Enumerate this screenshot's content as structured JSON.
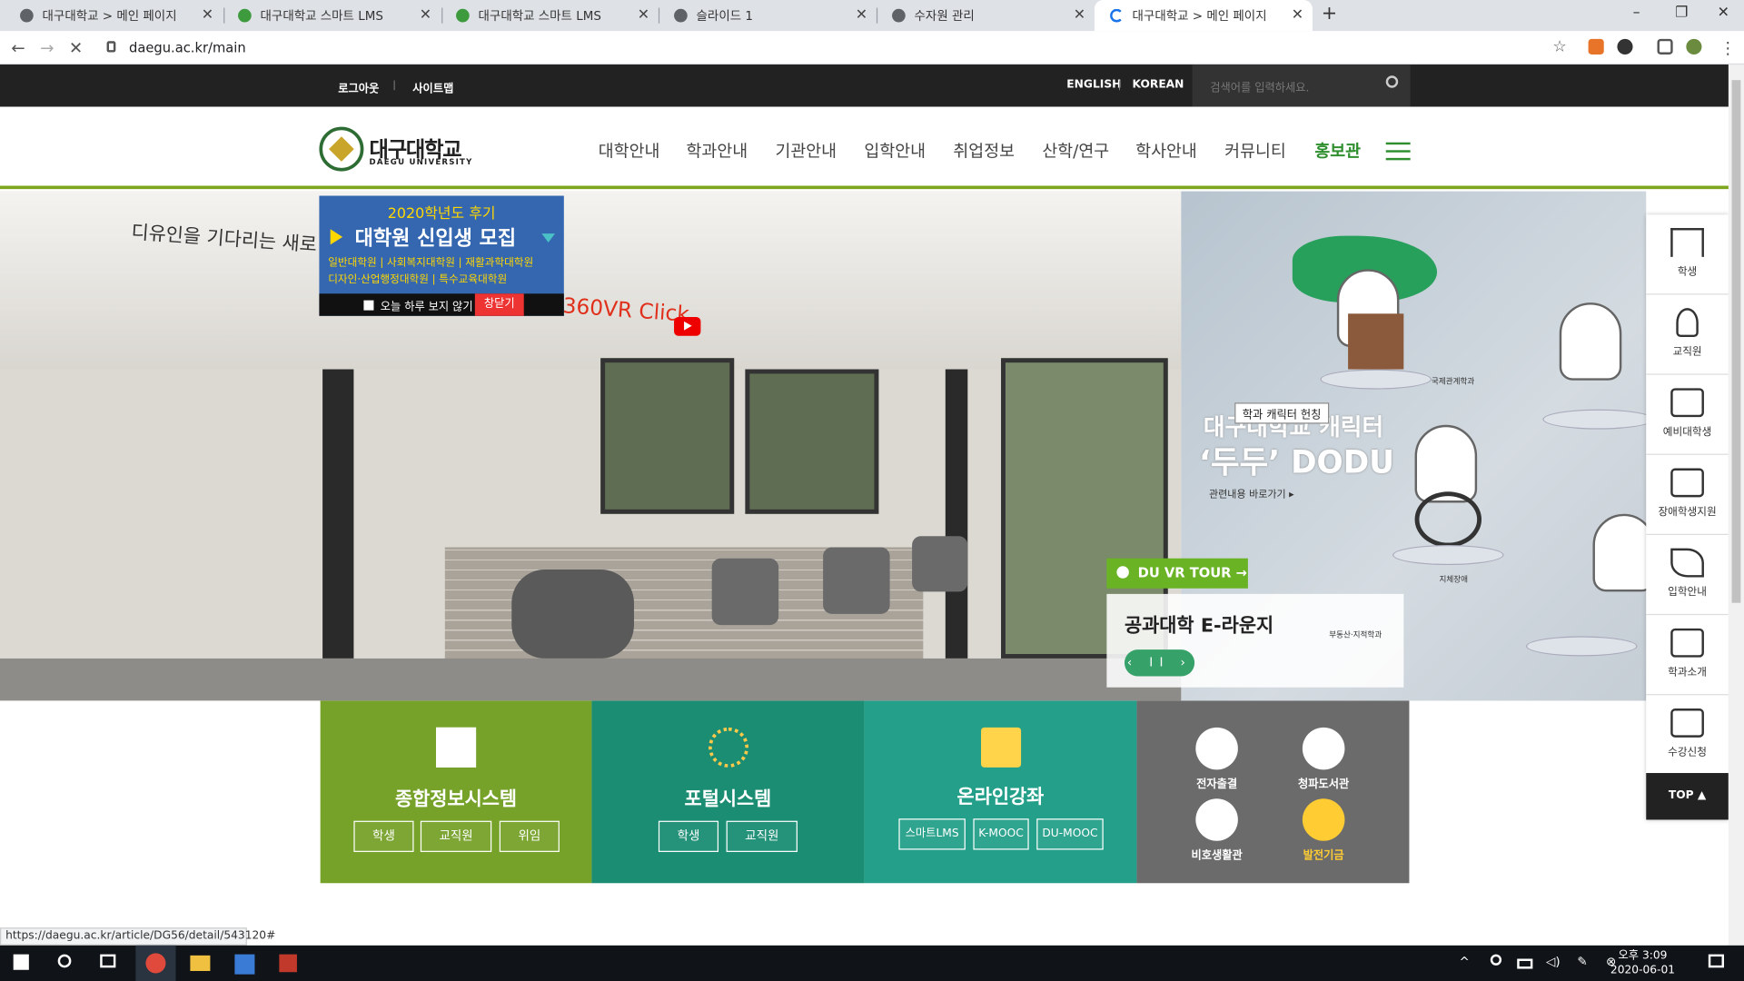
{
  "browser": {
    "tabs": [
      {
        "title": "대구대학교 > 메인 페이지",
        "active": false
      },
      {
        "title": "대구대학교 스마트 LMS",
        "active": false
      },
      {
        "title": "대구대학교 스마트 LMS",
        "active": false
      },
      {
        "title": "슬라이드 1",
        "active": false
      },
      {
        "title": "수자원 관리",
        "active": false
      },
      {
        "title": "대구대학교 > 메인 페이지",
        "active": true
      }
    ],
    "new_tab": "+",
    "url": "daegu.ac.kr/main",
    "status_url": "https://daegu.ac.kr/article/DG56/detail/543120#"
  },
  "utility": {
    "logout": "로그아웃",
    "sitemap": "사이트맵",
    "english": "ENGLISH",
    "korean": "KOREAN",
    "search_placeholder": "검색어를 입력하세요."
  },
  "header": {
    "logo_kr": "대구대학교",
    "logo_en": "DAEGU UNIVERSITY",
    "nav": [
      "대학안내",
      "학과안내",
      "기관안내",
      "입학안내",
      "취업정보",
      "산학/연구",
      "학사안내",
      "커뮤니티",
      "홍보관"
    ]
  },
  "hero": {
    "caption": "디유인을 기다리는 새로",
    "vr_click": "360VR Click"
  },
  "popup": {
    "line1": "2020학년도 후기",
    "line2": "대학원 신입생 모집",
    "line3": "일반대학원 | 사회복지대학원 | 재활과학대학원",
    "line4": "디자인·산업행정대학원 | 특수교육대학원",
    "dont_show": "오늘 하루 보지 않기",
    "close": "창닫기"
  },
  "character": {
    "title": "대구대학교 캐릭터",
    "name": "‘두두’ DODU",
    "link": "관련내용 바로가기 ▸",
    "tooltip": "학과 캐릭터 헌칭",
    "tag1": "국제관계학과",
    "tag2": "지체장애",
    "tag3": "부동산·지적학과"
  },
  "vr_tour": {
    "label": "DU VR TOUR →",
    "title": "공과대학 E-라운지",
    "controls": "‹ II ›"
  },
  "tiles": {
    "info_system": {
      "title": "종합정보시스템",
      "buttons": [
        "학생",
        "교직원",
        "위임"
      ]
    },
    "portal": {
      "title": "포털시스템",
      "buttons": [
        "학생",
        "교직원"
      ]
    },
    "online": {
      "title": "온라인강좌",
      "buttons": [
        "스마트LMS",
        "K-MOOC",
        "DU-MOOC"
      ]
    },
    "quick": [
      "전자출결",
      "청파도서관",
      "비호생활관",
      "발전기금"
    ]
  },
  "side_menu": {
    "items": [
      "학생",
      "교직원",
      "예비대학생",
      "장애학생지원",
      "입학안내",
      "학과소개",
      "수강신청"
    ],
    "top": "TOP ▲"
  },
  "taskbar": {
    "time": "오후 3:09",
    "date": "2020-06-01"
  },
  "colors": {
    "green": "#7ea51e",
    "teal": "#1a8d73",
    "teal2": "#24a08a",
    "gray": "#6b6b6b",
    "popup_blue": "#3567b0"
  }
}
